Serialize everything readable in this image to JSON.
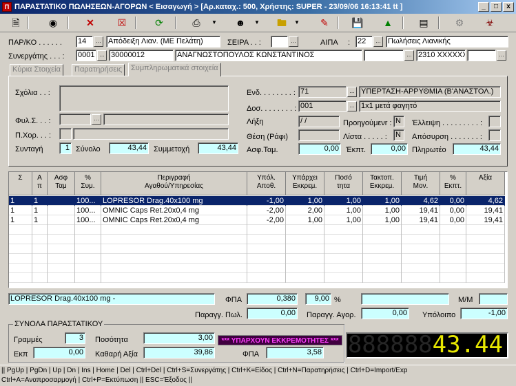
{
  "window": {
    "title": "ΠΑΡΑΣΤΑΤΙΚΟ ΠΩΛΗΣΕΩΝ-ΑΓΟΡΩΝ < Εισαγωγή > [Αρ.καταχ.: 500, Χρήστης: SUPER - 23/09/06 16:13:41 tt ]",
    "minimize": "_",
    "maximize": "□",
    "close": "x"
  },
  "toolbar": {
    "icons": [
      "new-document-icon",
      "binoculars-icon",
      "delete-icon",
      "cancel-icon",
      "refresh-icon",
      "print-icon",
      "people-icon",
      "folder-icon",
      "pencil-icon",
      "save-icon",
      "upload-icon",
      "money-icon",
      "tools-icon"
    ]
  },
  "header": {
    "parko_label": "ΠΑΡ/ΚΟ . . . . . .",
    "parko_code": "14",
    "parko_desc": "Απόδειξη Λιαν. (ΜΕ Πελάτη)",
    "seira_label": "ΣΕΙΡΑ . . :",
    "aipa_label": "ΑΙΠΑ",
    "aipa_code": "22",
    "aipa_desc": "Πωλήσεις Λιανικής",
    "synergatis_label": "Συνεργάτης . . . :",
    "syn_code1": "0001",
    "syn_code2": "30000012",
    "syn_name": "ΑΝΑΓΝΩΣΤΟΠΟΥΛΟΣ ΚΩΝΣΤΑΝΤΙΝΟΣ",
    "syn_phone": "2310 XXXXXX"
  },
  "tabs": [
    {
      "label": "Κύρια Στοιχεία"
    },
    {
      "label": "Παρατηρήσεις"
    },
    {
      "label": "Συμπληρωματικά στοιχεία"
    }
  ],
  "panel": {
    "sxolia_label": "Σχόλια . . :",
    "fyl_label": "Φυλ.Σ. . . :",
    "pxor_label": "Π.Χορ. . . :",
    "syntagi_label": "Συνταγή",
    "syntagi_value": "1",
    "synolo_label": "Σύνολο",
    "synolo_value": "43,44",
    "symmetoxi_label": "Συμμετοχή",
    "symmetoxi_value": "43,44",
    "end_label": "Ενδ. . . . . . . . :",
    "end_code": "71",
    "end_desc": "ΥΠΕΡΤΑΣΗ-ΑΡΡΥΘΜΙΑ (Β'ΑΝΑΣΤΟΛ.)",
    "dos_label": "Δοσ. . . . . . . . :",
    "dos_code": "001",
    "dos_desc": "1x1 μετά φαγητό",
    "lixi_label": "Λήξη",
    "lixi_value": "/ /",
    "proigoumenr_label": "Προηγούμενr :",
    "proigoumenr_value": "N",
    "elleipsi_label": "Έλλειψη . . . . . . . . . :",
    "thesi_label": "Θέση (Ράφι)",
    "lista_label": "Λίστα . . . . . :",
    "lista_value": "N",
    "aposyrsi_label": "Απόσυρση . . . . . . . :",
    "asftam_label": "Ασφ.Ταμ.",
    "asftam_value": "0,00",
    "ekpt_label": "Έκπτ.",
    "ekpt_value": "0,00",
    "pliroteo_label": "Πληρωτέο",
    "pliroteo_value": "43,44"
  },
  "grid": {
    "columns": [
      {
        "l1": "Σ",
        "l2": ""
      },
      {
        "l1": "Α",
        "l2": "π"
      },
      {
        "l1": "Ασφ",
        "l2": "Ταμ"
      },
      {
        "l1": "%",
        "l2": "Συμ."
      },
      {
        "l1": "Περιγραφή",
        "l2": "Αγαθού/Υπηρεσίας"
      },
      {
        "l1": "Υπόλ.",
        "l2": "Αποθ."
      },
      {
        "l1": "Υπάρχει",
        "l2": "Εκκρεμ."
      },
      {
        "l1": "Ποσό",
        "l2": "τητα"
      },
      {
        "l1": "Τακτοπ.",
        "l2": "Εκκρεμ."
      },
      {
        "l1": "Τιμή",
        "l2": "Μον."
      },
      {
        "l1": "%",
        "l2": "Εκπτ."
      },
      {
        "l1": "Αξία",
        "l2": ""
      }
    ],
    "rows": [
      [
        "1",
        "1",
        "",
        "100...",
        "LOPRESOR Drag.40x100 mg",
        "-1,00",
        "1,00",
        "1,00",
        "1,00",
        "4,62",
        "0,00",
        "4,62"
      ],
      [
        "1",
        "1",
        "",
        "100...",
        "OMNIC Caps Ret.20x0,4 mg",
        "-2,00",
        "2,00",
        "1,00",
        "1,00",
        "19,41",
        "0,00",
        "19,41"
      ],
      [
        "1",
        "1",
        "",
        "100...",
        "OMNIC Caps Ret.20x0,4 mg",
        "-2,00",
        "1,00",
        "1,00",
        "1,00",
        "19,41",
        "0,00",
        "19,41"
      ]
    ]
  },
  "bottom": {
    "item_desc": "LOPRESOR Drag.40x100 mg -",
    "fpa_label": "ΦΠΑ",
    "fpa_amount": "0,380",
    "fpa_rate": "9,00",
    "percent": "%",
    "mm_label": "M/M",
    "paragg_pol_label": "Παραγγ. Πωλ.",
    "paragg_pol_value": "0,00",
    "paragg_agor_label": "Παραγγ. Αγορ.",
    "paragg_agor_value": "0,00",
    "ypoloipo_label": "Υπόλοιπο",
    "ypoloipo_value": "-1,00"
  },
  "totals": {
    "title": "ΣΥΝΟΛΑ ΠΑΡΑΣΤΑΤΙΚΟΥ",
    "grammes_label": "Γραμμές",
    "grammes_value": "3",
    "posotita_label": "Ποσότητα",
    "posotita_value": "3,00",
    "ekp_label": "Εκπ",
    "ekp_value": "0,00",
    "kathari_label": "Καθαρή Αξία",
    "kathari_value": "39,86",
    "fpa_label": "ΦΠΑ",
    "fpa_value": "3,58",
    "banner": "*** ΥΠΑΡΧΟΥΝ ΕΚΚΡΕΜΟΤΗΤΕΣ ***",
    "display_ghost": "888888",
    "display_value": "43.44"
  },
  "status": {
    "line1": "|| PgUp | PgDn | Up | Dn | Ins | Home | Del | Ctrl+Del | Ctrl+S=Συνεργάτης | Ctrl+K=Είδος | Ctrl+N=Παρατηρήσεις | Ctrl+D=Import/Exp",
    "line2": "Ctrl+A=Αναπροσαρμογή | Ctrl+P=Εκτύπωση || ESC=Έξοδος ||"
  },
  "colors": {
    "accent": "#0a246a",
    "field_highlight": "#ccffff",
    "display_digits": "#e8e800",
    "banner_text": "#ff40ff"
  }
}
